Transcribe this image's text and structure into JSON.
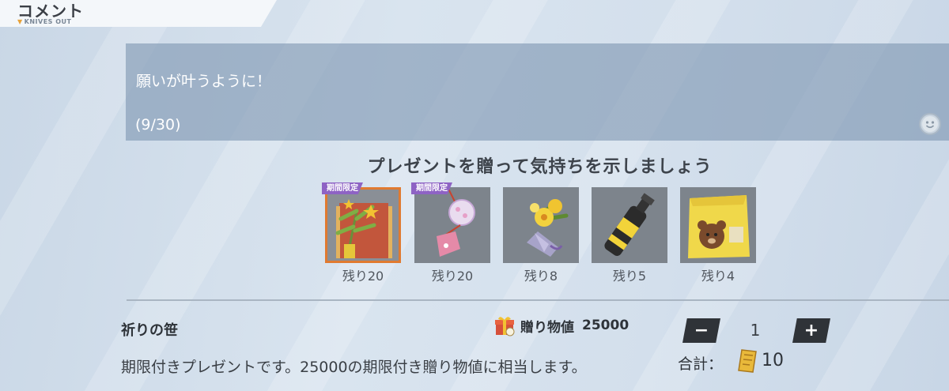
{
  "header": {
    "title": "コメント",
    "subtitle": "KNIVES OUT"
  },
  "comment": {
    "text": "願いが叶うように！",
    "count": "(9/30)"
  },
  "gifts": {
    "heading": "プレゼントを贈って気持ちを示しましょう",
    "items": [
      {
        "name": "tanabata-bamboo",
        "badge": "期間限定",
        "remaining": "残り20",
        "selected": true
      },
      {
        "name": "wind-chime",
        "badge": "期間限定",
        "remaining": "残り20",
        "selected": false
      },
      {
        "name": "flower-bouquet",
        "badge": "",
        "remaining": "残り8",
        "selected": false
      },
      {
        "name": "soda-bottle",
        "badge": "",
        "remaining": "残り5",
        "selected": false
      },
      {
        "name": "cookie-bag",
        "badge": "",
        "remaining": "残り4",
        "selected": false
      }
    ]
  },
  "detail": {
    "name": "祈りの笹",
    "value_label": "贈り物値",
    "value": "25000",
    "description": "期限付きプレゼントです。25000の期限付き贈り物値に相当します。"
  },
  "quantity": {
    "minus": "−",
    "value": "1",
    "plus": "+"
  },
  "total": {
    "label": "合計：",
    "value": "10"
  },
  "colors": {
    "selected_outline": "#e07a30",
    "badge": "#8e63c4",
    "button": "#2f3338"
  }
}
